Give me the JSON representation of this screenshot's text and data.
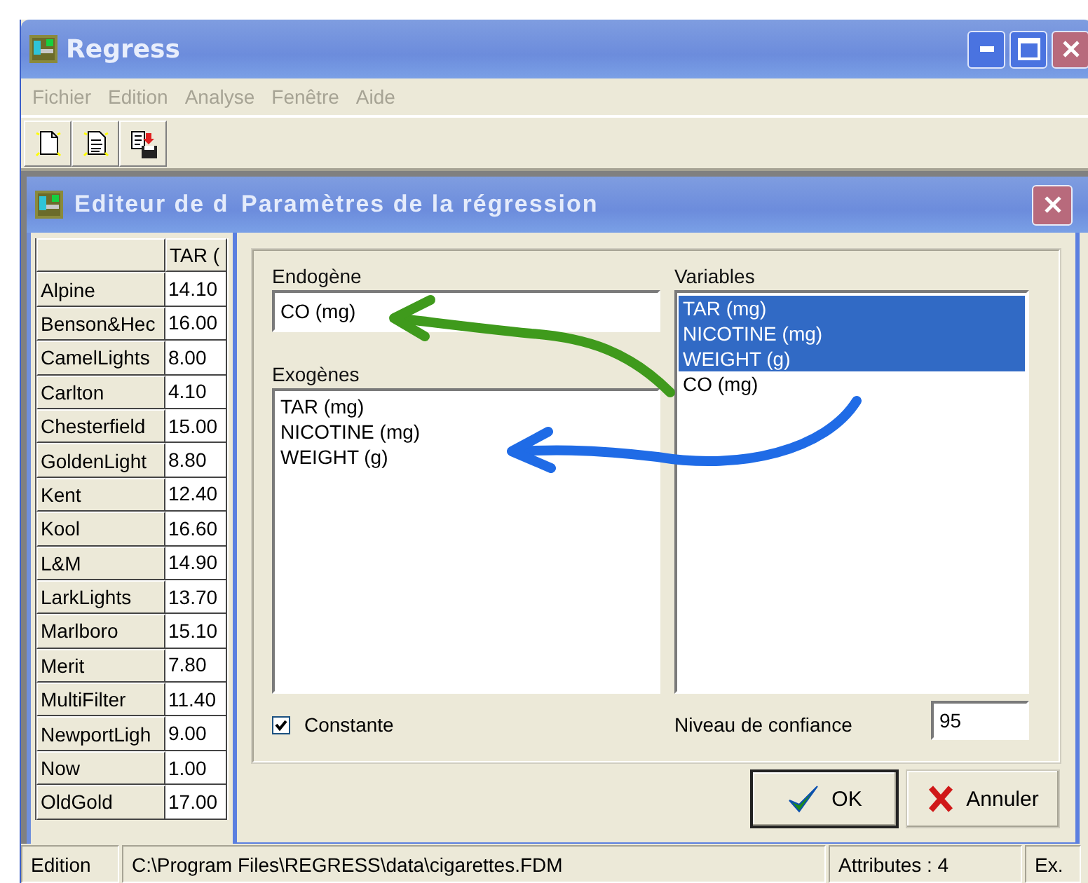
{
  "window": {
    "title": "Regress"
  },
  "menu": [
    {
      "label": "Fichier",
      "disabled": true
    },
    {
      "label": "Edition",
      "disabled": true
    },
    {
      "label": "Analyse",
      "disabled": true
    },
    {
      "label": "Fenêtre",
      "disabled": true
    },
    {
      "label": "Aide",
      "disabled": true
    }
  ],
  "toolbar": [
    {
      "kind": "new"
    },
    {
      "kind": "open"
    },
    {
      "kind": "save"
    }
  ],
  "editor": {
    "title": "Editeur de d",
    "columns": [
      "TAR ("
    ],
    "rows": [
      {
        "name": "Alpine",
        "value": "14.10"
      },
      {
        "name": "Benson&Hec",
        "value": "16.00"
      },
      {
        "name": "CamelLights",
        "value": "8.00"
      },
      {
        "name": "Carlton",
        "value": "4.10"
      },
      {
        "name": "Chesterfield",
        "value": "15.00"
      },
      {
        "name": "GoldenLight",
        "value": "8.80"
      },
      {
        "name": "Kent",
        "value": "12.40"
      },
      {
        "name": "Kool",
        "value": "16.60"
      },
      {
        "name": "L&M",
        "value": "14.90"
      },
      {
        "name": "LarkLights",
        "value": "13.70"
      },
      {
        "name": "Marlboro",
        "value": "15.10"
      },
      {
        "name": "Merit",
        "value": "7.80"
      },
      {
        "name": "MultiFilter",
        "value": "11.40"
      },
      {
        "name": "NewportLigh",
        "value": "9.00"
      },
      {
        "name": "Now",
        "value": "1.00"
      },
      {
        "name": "OldGold",
        "value": "17.00"
      }
    ]
  },
  "dialog": {
    "title": "Paramètres de la régression",
    "endogene": {
      "label": "Endogène",
      "value": "CO (mg)"
    },
    "exogenes": {
      "label": "Exogènes",
      "items": [
        "TAR (mg)",
        "NICOTINE (mg)",
        "WEIGHT (g)"
      ]
    },
    "variables": {
      "label": "Variables",
      "items": [
        {
          "label": "TAR (mg)",
          "selected": true
        },
        {
          "label": "NICOTINE (mg)",
          "selected": true
        },
        {
          "label": "WEIGHT (g)",
          "selected": true
        },
        {
          "label": "CO (mg)",
          "selected": false
        }
      ]
    },
    "constante": {
      "label": "Constante",
      "checked": true
    },
    "confidence": {
      "label": "Niveau de confiance",
      "value": "95"
    },
    "buttons": [
      {
        "kind": "ok",
        "label": "OK"
      },
      {
        "kind": "cancel",
        "label": "Annuler"
      }
    ],
    "annotations": [
      {
        "kind": "arrow",
        "color": "#3f9a1c"
      },
      {
        "kind": "arrow",
        "color": "#1f6be6"
      }
    ]
  },
  "status_bar": [
    "Edition",
    "C:\\Program Files\\REGRESS\\data\\cigarettes.FDM",
    "Attributes : 4",
    "Ex."
  ]
}
